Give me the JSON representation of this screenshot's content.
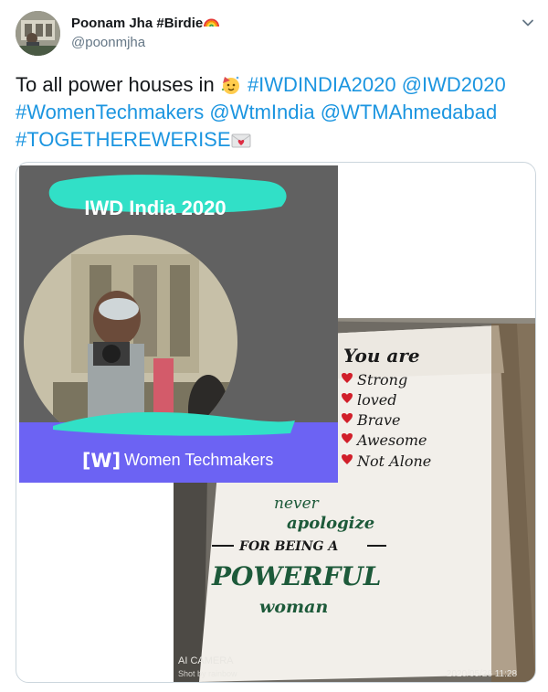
{
  "author": {
    "display_name": "Poonam Jha #Birdie",
    "handle": "@poonmjha",
    "name_emoji": "rainbow-emoji"
  },
  "tweet": {
    "text_prefix": "To all power houses in",
    "party_emoji": "party-face-emoji",
    "hashtag_iwdindia": "#IWDINDIA2020",
    "mention_iwd": "@IWD2020",
    "hashtag_womentechmakers": "#WomenTechmakers",
    "mention_wtmindia": "@WtmIndia",
    "mention_wtmahmedabad": "@WTMAhmedabad",
    "hashtag_togetherewerise": "#TOGETHEREWERISE",
    "letter_emoji": "love-letter-emoji"
  },
  "media": {
    "badge_title": "IWD India 2020",
    "brand_mark": "[W]",
    "brand_name": "Women Techmakers",
    "note_heading": "You are",
    "note_list": [
      "Strong",
      "loved",
      "Brave",
      "Awesome",
      "Not Alone"
    ],
    "quote_line1": "never",
    "quote_line2": "apologize",
    "quote_line3": "FOR BEING A",
    "quote_line4": "POWERFUL",
    "quote_line5": "woman",
    "camera_label": "AI CAMERA",
    "camera_shot_by": "Shot by rainbow",
    "photo_timestamp": "2020/05/26 11:28"
  },
  "colors": {
    "link": "#1b95e0",
    "teal_brush": "#31e0c7",
    "wtm_purple": "#6c63f3",
    "marker_green": "#1d5a3a",
    "heart_red": "#d11f2a"
  }
}
